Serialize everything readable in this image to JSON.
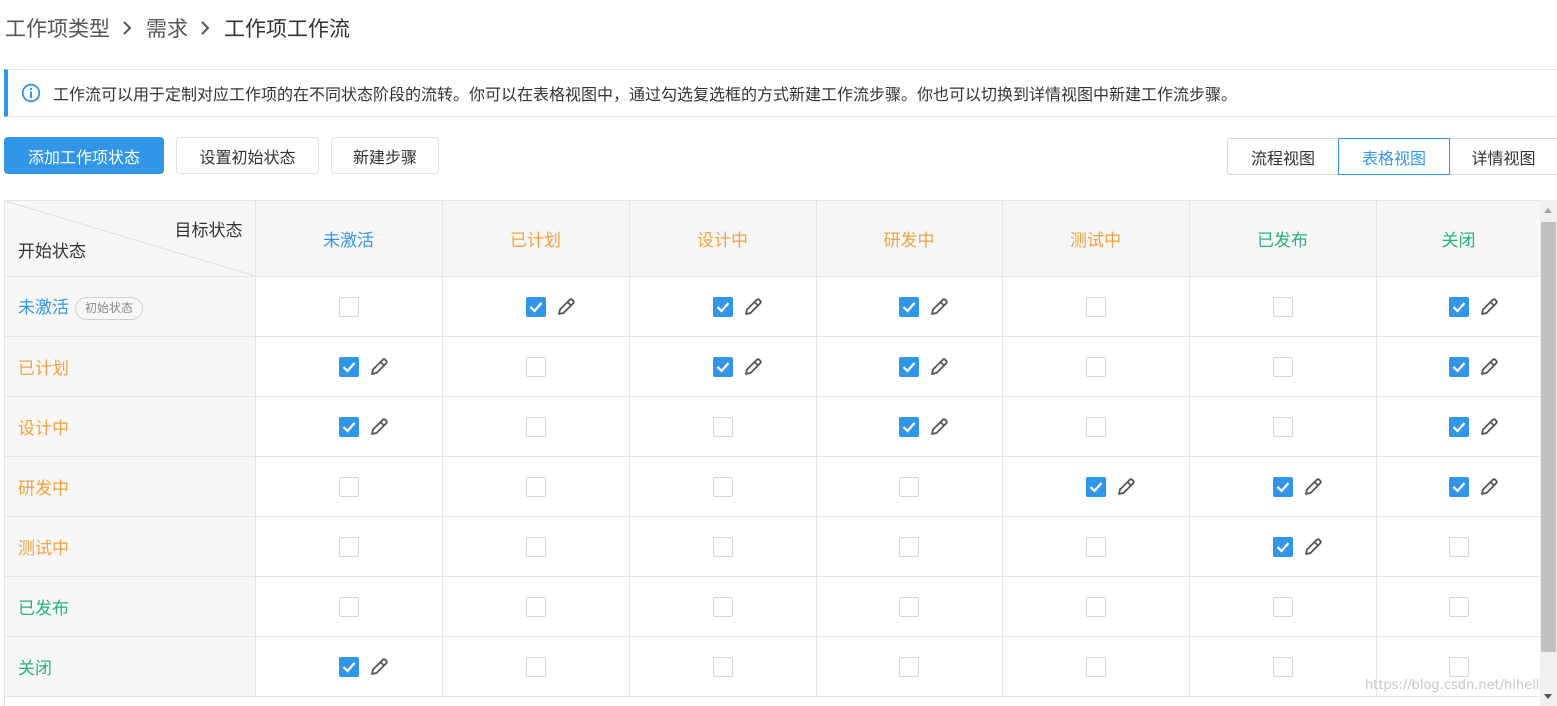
{
  "breadcrumb": [
    "工作项类型",
    "需求",
    "工作项工作流"
  ],
  "notice": {
    "icon": "info-circle-icon",
    "text": "工作流可以用于定制对应工作项的在不同状态阶段的流转。你可以在表格视图中，通过勾选复选框的方式新建工作流步骤。你也可以切换到详情视图中新建工作流步骤。"
  },
  "toolbar": {
    "add_state": "添加工作项状态",
    "set_initial": "设置初始状态",
    "new_step": "新建步骤"
  },
  "views": [
    "流程视图",
    "表格视图",
    "详情视图"
  ],
  "active_view": "表格视图",
  "colors": {
    "accent": "#3296e8",
    "blue": "#3296e8",
    "orange": "#f0a33e",
    "green": "#27b276"
  },
  "matrix": {
    "corner_target": "目标状态",
    "corner_source": "开始状态",
    "initial_badge": "初始状态",
    "states": [
      {
        "name": "未激活",
        "color": "blue",
        "initial": true
      },
      {
        "name": "已计划",
        "color": "orange"
      },
      {
        "name": "设计中",
        "color": "orange"
      },
      {
        "name": "研发中",
        "color": "orange"
      },
      {
        "name": "测试中",
        "color": "orange"
      },
      {
        "name": "已发布",
        "color": "green"
      },
      {
        "name": "关闭",
        "color": "green"
      }
    ],
    "transitions": [
      [
        0,
        1,
        1,
        1,
        0,
        0,
        1
      ],
      [
        1,
        0,
        1,
        1,
        0,
        0,
        1
      ],
      [
        1,
        0,
        0,
        1,
        0,
        0,
        1
      ],
      [
        0,
        0,
        0,
        0,
        1,
        1,
        1
      ],
      [
        0,
        0,
        0,
        0,
        0,
        1,
        0
      ],
      [
        0,
        0,
        0,
        0,
        0,
        0,
        0
      ],
      [
        1,
        0,
        0,
        0,
        0,
        0,
        0
      ]
    ]
  },
  "watermark": "https://blog.csdn.net/hihell"
}
